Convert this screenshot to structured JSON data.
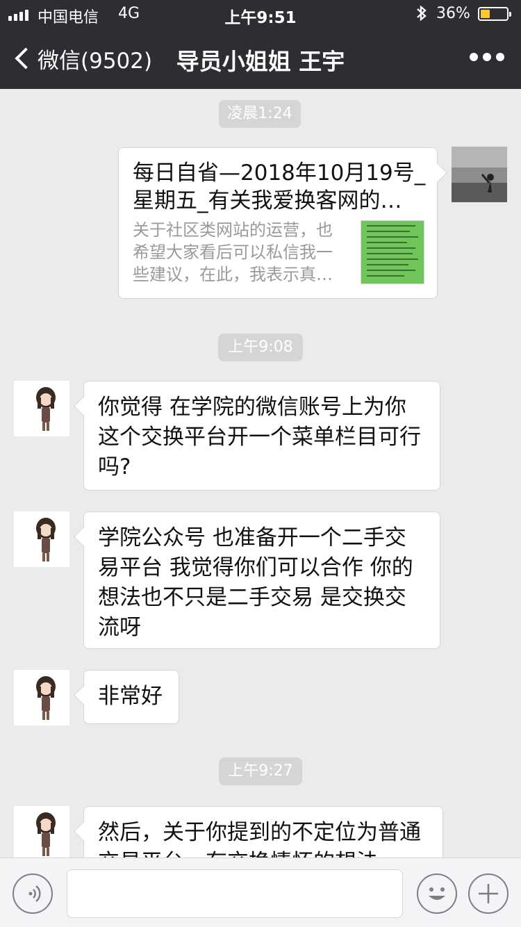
{
  "status_bar": {
    "carrier": "中国电信",
    "network": "4G",
    "time": "上午9:51",
    "battery_percent": "36%",
    "battery_level": 0.36,
    "signal_icon": "signal-bars-icon",
    "bluetooth_icon": "bluetooth-icon"
  },
  "nav": {
    "back_label": "微信(9502)",
    "title": "导员小姐姐 王宇",
    "more_icon": "more-dots-icon"
  },
  "messages": {
    "t1": "凌晨1:24",
    "card": {
      "title_line1": "每日自省—2018年10月19号_",
      "title_line2": "星期五_有关我爱换客网的…",
      "desc": "关于社区类网站的运营，也希望大家看后可以私信我一些建议，在此，我表示真…"
    },
    "t2": "上午9:08",
    "m1": "你觉得   在学院的微信账号上为你这个交换平台开一个菜单栏目可行吗?",
    "m2": "学院公众号  也准备开一个二手交易平台   我觉得你们可以合作  你的想法也不只是二手交易   是交换交流呀",
    "m3": "非常好",
    "t3": "上午9:27",
    "m4": "然后，关于你提到的不定位为普通交易平台，有交换情怀的想法"
  },
  "input_bar": {
    "voice_icon": "voice-icon",
    "emoji_icon": "emoji-icon",
    "plus_icon": "plus-icon"
  },
  "colors": {
    "nav_bg": "#2e2e32",
    "chat_bg": "#ebebeb",
    "time_chip": "#d5d5d5",
    "battery": "#f7c82f"
  }
}
